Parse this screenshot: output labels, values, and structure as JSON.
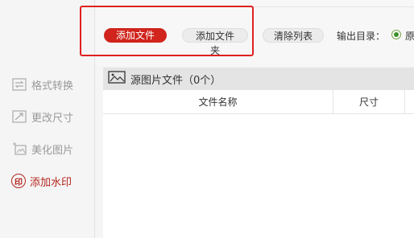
{
  "sidebar": {
    "items": [
      {
        "label": "格式转换",
        "icon": "convert-icon"
      },
      {
        "label": "更改尺寸",
        "icon": "resize-icon"
      },
      {
        "label": "美化图片",
        "icon": "beautify-icon"
      },
      {
        "label": "添加水印",
        "icon": "watermark-icon",
        "icon_text": "印",
        "active": true
      }
    ]
  },
  "toolbar": {
    "add_file": "添加文件",
    "add_folder": "添加文件夹",
    "clear_list": "清除列表",
    "output_label": "输出目录：",
    "output_option": "原"
  },
  "list": {
    "title": "源图片文件（0个）",
    "columns": [
      "文件名称",
      "尺寸"
    ]
  },
  "colors": {
    "accent": "#d0241c",
    "highlight": "#e02020",
    "active": "#b3261e"
  }
}
